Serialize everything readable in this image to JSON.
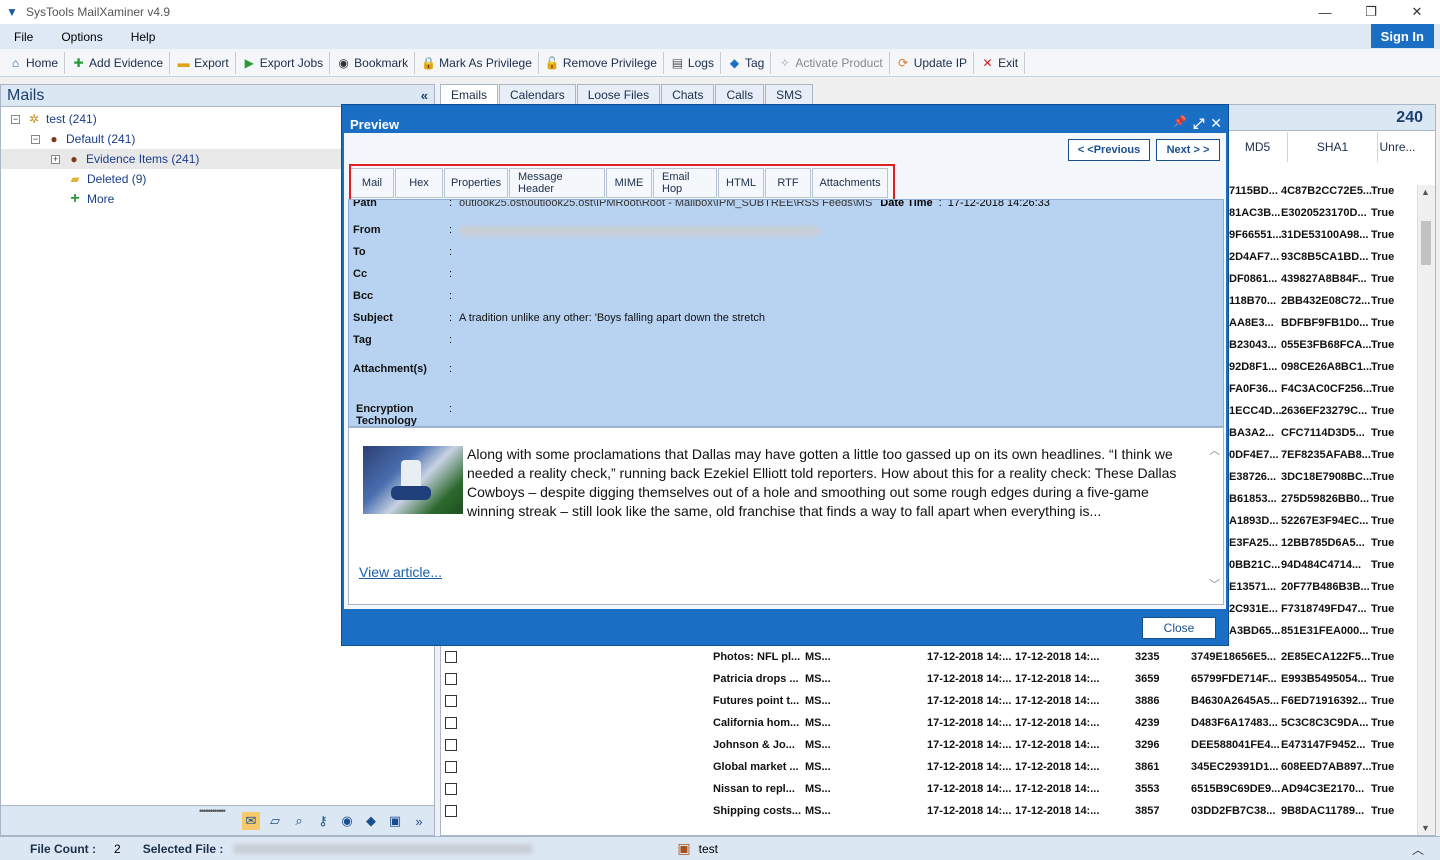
{
  "window": {
    "title": "SysTools MailXaminer v4.9",
    "minimize": "—",
    "restore": "❐",
    "close": "✕"
  },
  "menu": {
    "items": [
      "File",
      "Options",
      "Help"
    ],
    "sign_in": "Sign In"
  },
  "toolbar": [
    {
      "label": "Home",
      "icon": "home-icon",
      "glyph": "⌂"
    },
    {
      "label": "Add Evidence",
      "icon": "add-evidence-icon",
      "glyph": "✚"
    },
    {
      "label": "Export",
      "icon": "export-icon",
      "glyph": "▬"
    },
    {
      "label": "Export Jobs",
      "icon": "export-jobs-icon",
      "glyph": "▶"
    },
    {
      "label": "Bookmark",
      "icon": "eye-icon",
      "glyph": "◉"
    },
    {
      "label": "Mark As Privilege",
      "icon": "lock-icon",
      "glyph": "🔒"
    },
    {
      "label": "Remove Privilege",
      "icon": "unlock-icon",
      "glyph": "🔓"
    },
    {
      "label": "Logs",
      "icon": "logs-icon",
      "glyph": "▤"
    },
    {
      "label": "Tag",
      "icon": "tag-icon",
      "glyph": "◆"
    },
    {
      "label": "Activate Product",
      "icon": "key-icon",
      "glyph": "✧"
    },
    {
      "label": "Update IP",
      "icon": "update-icon",
      "glyph": "⟳"
    },
    {
      "label": "Exit",
      "icon": "exit-icon",
      "glyph": "✕"
    }
  ],
  "left_panel": {
    "title": "Mails",
    "collapse": "«",
    "tree": [
      {
        "label": "test",
        "count": "(241)",
        "icon": "case-icon"
      },
      {
        "label": "Default",
        "count": "(241)",
        "icon": "user-icon"
      },
      {
        "label": "Evidence Items",
        "count": "(241)",
        "icon": "user-icon"
      },
      {
        "label": "Deleted",
        "count": "(9)",
        "icon": "folder-icon"
      },
      {
        "label": "More",
        "count": "",
        "icon": "plus-icon"
      }
    ]
  },
  "tabs": [
    "Emails",
    "Calendars",
    "Loose Files",
    "Chats",
    "Calls",
    "SMS"
  ],
  "grid": {
    "count": "240",
    "headers": [
      "MD5",
      "SHA1",
      "Unre..."
    ],
    "right_rows": [
      [
        "7115BD...",
        "4C87B2CC72E5...",
        "True"
      ],
      [
        "81AC3B...",
        "E3020523170D...",
        "True"
      ],
      [
        "9F66551...",
        "31DE53100A98...",
        "True"
      ],
      [
        "2D4AF7...",
        "93C8B5CA1BD...",
        "True"
      ],
      [
        "DF0861...",
        "439827A8B84F...",
        "True"
      ],
      [
        "118B70...",
        "2BB432E08C72...",
        "True"
      ],
      [
        "AA8E3...",
        "BDFBF9FB1D0...",
        "True"
      ],
      [
        "B23043...",
        "055E3FB68FCA...",
        "True"
      ],
      [
        "92D8F1...",
        "098CE26A8BC1...",
        "True"
      ],
      [
        "FA0F36...",
        "F4C3AC0CF256...",
        "True"
      ],
      [
        "1ECC4D...",
        "2636EF23279C...",
        "True"
      ],
      [
        "BA3A2...",
        "CFC7114D3D5...",
        "True"
      ],
      [
        "0DF4E7...",
        "7EF8235AFAB8...",
        "True"
      ],
      [
        "E38726...",
        "3DC18E7908BC...",
        "True"
      ],
      [
        "B61853...",
        "275D59826BB0...",
        "True"
      ],
      [
        "A1893D...",
        "52267E3F94EC...",
        "True"
      ],
      [
        "E3FA25...",
        "12BB785D6A5...",
        "True"
      ],
      [
        "0BB21C...",
        "94D484C4714...",
        "True"
      ],
      [
        "E13571...",
        "20F77B486B3B...",
        "True"
      ],
      [
        "2C931E...",
        "F7318749FD47...",
        "True"
      ],
      [
        "A3BD65...",
        "851E31FEA000...",
        "True"
      ]
    ],
    "rows": [
      {
        "subject": "Photos: NFL pl...",
        "from": "MS...",
        "sent": "17-12-2018 14:...",
        "received": "17-12-2018 14:...",
        "size": "3235",
        "md5": "3749E18656E5...",
        "sha1": "2E85ECA122F5...",
        "unread": "True"
      },
      {
        "subject": "Patricia drops ...",
        "from": "MS...",
        "sent": "17-12-2018 14:...",
        "received": "17-12-2018 14:...",
        "size": "3659",
        "md5": "65799FDE714F...",
        "sha1": "E993B5495054...",
        "unread": "True"
      },
      {
        "subject": "Futures point t...",
        "from": "MS...",
        "sent": "17-12-2018 14:...",
        "received": "17-12-2018 14:...",
        "size": "3886",
        "md5": "B4630A2645A5...",
        "sha1": "F6ED71916392...",
        "unread": "True"
      },
      {
        "subject": "California hom...",
        "from": "MS...",
        "sent": "17-12-2018 14:...",
        "received": "17-12-2018 14:...",
        "size": "4239",
        "md5": "D483F6A17483...",
        "sha1": "5C3C8C3C9DA...",
        "unread": "True"
      },
      {
        "subject": "Johnson & Jo...",
        "from": "MS...",
        "sent": "17-12-2018 14:...",
        "received": "17-12-2018 14:...",
        "size": "3296",
        "md5": "DEE588041FE4...",
        "sha1": "E473147F9452...",
        "unread": "True"
      },
      {
        "subject": "Global market ...",
        "from": "MS...",
        "sent": "17-12-2018 14:...",
        "received": "17-12-2018 14:...",
        "size": "3861",
        "md5": "345EC29391D1...",
        "sha1": "608EED7AB897...",
        "unread": "True"
      },
      {
        "subject": "Nissan to repl...",
        "from": "MS...",
        "sent": "17-12-2018 14:...",
        "received": "17-12-2018 14:...",
        "size": "3553",
        "md5": "6515B9C69DE9...",
        "sha1": "AD94C3E2170...",
        "unread": "True"
      },
      {
        "subject": "Shipping costs...",
        "from": "MS...",
        "sent": "17-12-2018 14:...",
        "received": "17-12-2018 14:...",
        "size": "3857",
        "md5": "03DD2FB7C38...",
        "sha1": "9B8DAC11789...",
        "unread": "True"
      }
    ]
  },
  "preview": {
    "title": "Preview",
    "pin": "📌",
    "expand": "⤢",
    "close_x": "✕",
    "prev_label": "< <Previous",
    "next_label": "Next > >",
    "tabs": [
      "Mail",
      "Hex",
      "Properties",
      "Message Header",
      "MIME",
      "Email Hop",
      "HTML",
      "RTF",
      "Attachments"
    ],
    "fields": {
      "path_label": "Path",
      "path_value": "outlook25.ost\\outlook25.ost\\IPMRoot\\Root - Mailbox\\IPM_SUBTREE\\RSS Feeds\\MS",
      "date_label": "Date Time",
      "date_value": "17-12-2018 14:26:33",
      "from_label": "From",
      "to_label": "To",
      "cc_label": "Cc",
      "bcc_label": "Bcc",
      "subject_label": "Subject",
      "subject_value": "A tradition unlike any other: 'Boys falling apart down the stretch",
      "tag_label": "Tag",
      "attachments_label": "Attachment(s)",
      "encryption_label_1": "Encryption",
      "encryption_label_2": "Technology",
      "colon": ":"
    },
    "body_text": "Along with some proclamations that Dallas may have gotten a little too gassed up on its own headlines. “I think we needed a reality check,” running back Ezekiel Elliott told reporters. How about this for a reality check: These Dallas Cowboys – despite digging themselves out of a hole and smoothing out some rough edges during a five-game winning streak – still look like the same, old franchise that finds a way to fall apart when everything is...",
    "link_text": "View article...",
    "close_label": "Close"
  },
  "status": {
    "file_count_label": "File Count :",
    "file_count": "2",
    "selected_file_label": "Selected File :",
    "case_name": "test"
  },
  "colors": {
    "accent": "#1a6fc4",
    "highlight": "#e02020",
    "panel": "#dce7f4"
  }
}
